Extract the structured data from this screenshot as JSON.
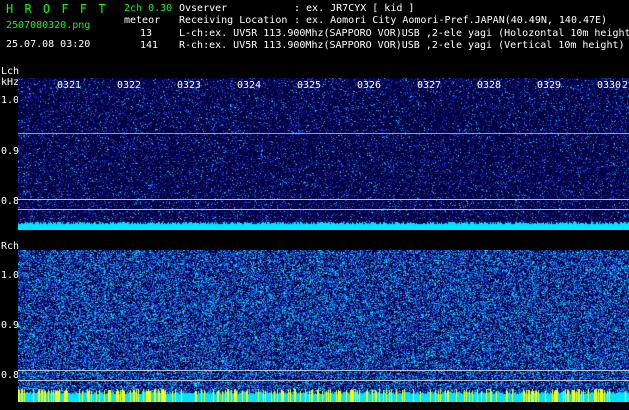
{
  "header": {
    "logo": "H R O F F T",
    "filename": "2507080320.png",
    "datetime": "25.07.08 03:20",
    "channel_info": "2ch 0.30",
    "meteor_label": "meteor",
    "meteor_lch": "13",
    "meteor_rch": "141",
    "observer_label": "Ovserver",
    "observer_value": ": ex. JR7CYX [ kid ]",
    "location_label": "Receiving Location",
    "location_value": ": ex. Aomori City Aomori-Pref.JAPAN(40.49N, 140.47E)",
    "lch_line": "L-ch:ex. UV5R 113.900Mhz(SAPPORO VOR)USB ,2-ele yagi (Holozontal 10m height)",
    "rch_line": "R-ch:ex. UV5R 113.900Mhz(SAPPORO VOR)USB ,2-ele yagi (Vertical 10m height)"
  },
  "colors": {
    "logo": "#00ff00",
    "meta": "#ffffff",
    "panel_bg": "#000044",
    "noise_low": "#1f3fbf",
    "noise_high": "#00e5ff",
    "marker": "#ffff00",
    "baseline": "#00e5ff"
  },
  "lch_panel": {
    "label": "Lch",
    "unit": "kHz",
    "y_ticks": [
      "1.0",
      "0.9",
      "0.8"
    ],
    "time_ticks": [
      "0321",
      "0322",
      "0323",
      "0324",
      "0325",
      "0326",
      "0327",
      "0328",
      "0329",
      "0330"
    ],
    "edge_tick": "2"
  },
  "rch_panel": {
    "label": "Rch",
    "y_ticks": [
      "1.0",
      "0.9",
      "0.8"
    ]
  }
}
